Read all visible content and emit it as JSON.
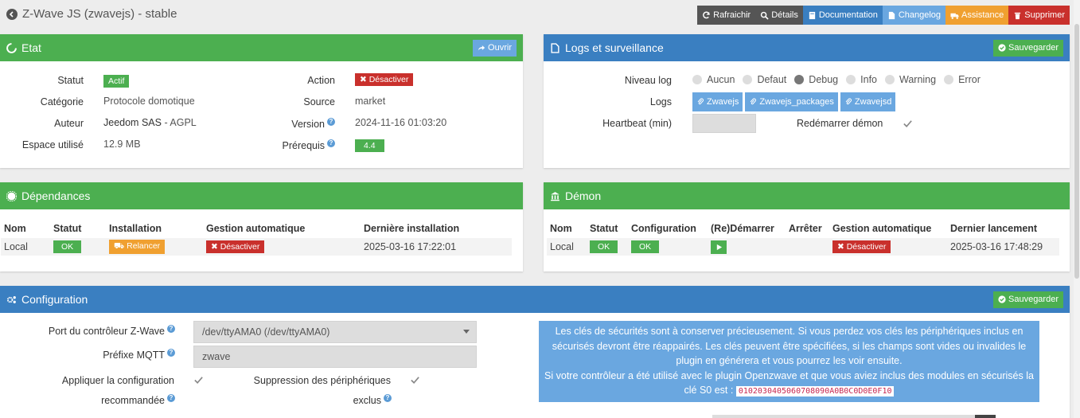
{
  "header": {
    "title": "Z-Wave JS (zwavejs) - stable",
    "buttons": [
      {
        "label": "Rafraichir",
        "icon": "refresh-icon",
        "color": "#555555"
      },
      {
        "label": "Détails",
        "icon": "search-icon",
        "color": "#555555"
      },
      {
        "label": "Documentation",
        "icon": "book-icon",
        "color": "#3a7fc1"
      },
      {
        "label": "Changelog",
        "icon": "file-icon",
        "color": "#6aa7e0"
      },
      {
        "label": "Assistance",
        "icon": "truck-icon",
        "color": "#f0a030"
      },
      {
        "label": "Supprimer",
        "icon": "trash-icon",
        "color": "#c9302c"
      }
    ]
  },
  "etat": {
    "title": "Etat",
    "open_label": "Ouvrir",
    "statut_label": "Statut",
    "statut_value": "Actif",
    "categorie_label": "Catégorie",
    "categorie_value": "Protocole domotique",
    "auteur_label": "Auteur",
    "auteur_value": "Jeedom SAS",
    "license": "- AGPL",
    "espace_label": "Espace utilisé",
    "espace_value": "12.9 MB",
    "action_label": "Action",
    "action_value": "Désactiver",
    "source_label": "Source",
    "source_value": "market",
    "version_label": "Version",
    "version_value": "2024-11-16 01:03:20",
    "prerequis_label": "Prérequis",
    "prerequis_value": "4.4"
  },
  "logs": {
    "title": "Logs et surveillance",
    "save_label": "Sauvegarder",
    "niveau_label": "Niveau log",
    "levels": [
      "Aucun",
      "Defaut",
      "Debug",
      "Info",
      "Warning",
      "Error"
    ],
    "selected_level": "Debug",
    "logs_label": "Logs",
    "log_buttons": [
      "Zwavejs",
      "Zwavejs_packages",
      "Zwavejsd"
    ],
    "heartbeat_label": "Heartbeat (min)",
    "redemarrer_label": "Redémarrer démon"
  },
  "dependances": {
    "title": "Dépendances",
    "headers": [
      "Nom",
      "Statut",
      "Installation",
      "Gestion automatique",
      "Dernière installation"
    ],
    "row": {
      "nom": "Local",
      "statut": "OK",
      "installation": "Relancer",
      "gestion": "Désactiver",
      "derniere": "2025-03-16 17:22:01"
    }
  },
  "demon": {
    "title": "Démon",
    "headers": [
      "Nom",
      "Statut",
      "Configuration",
      "(Re)Démarrer",
      "Arrêter",
      "Gestion automatique",
      "Dernier lancement"
    ],
    "row": {
      "nom": "Local",
      "statut": "OK",
      "configuration": "OK",
      "gestion": "Désactiver",
      "dernier": "2025-03-16 17:48:29"
    }
  },
  "configuration": {
    "title": "Configuration",
    "save_label": "Sauvegarder",
    "port_label": "Port du contrôleur Z-Wave",
    "port_value": "/dev/ttyAMA0 (/dev/ttyAMA0)",
    "prefix_label": "Préfixe MQTT",
    "prefix_value": "zwave",
    "apply_label_1": "Appliquer la configuration",
    "apply_label_2": "recommandée",
    "suppression_label_1": "Suppression des périphériques",
    "suppression_label_2": "exclus",
    "info_text": "Les clés de sécurités sont à conserver précieusement. Si vous perdez vos clés les périphériques inclus en sécurisés devront être réappairés. Les clés peuvent être spécifiées, si les champs sont vides ou invalides le plugin en générera et vous pourrez les voir ensuite.",
    "info_text_2": "Si votre contrôleur a été utilisé avec le plugin Openzwave et que vous aviez inclus des modules en sécurisés la clé S0 est :",
    "s0_key": "0102030405060708090A0B0C0D0E0F10"
  }
}
